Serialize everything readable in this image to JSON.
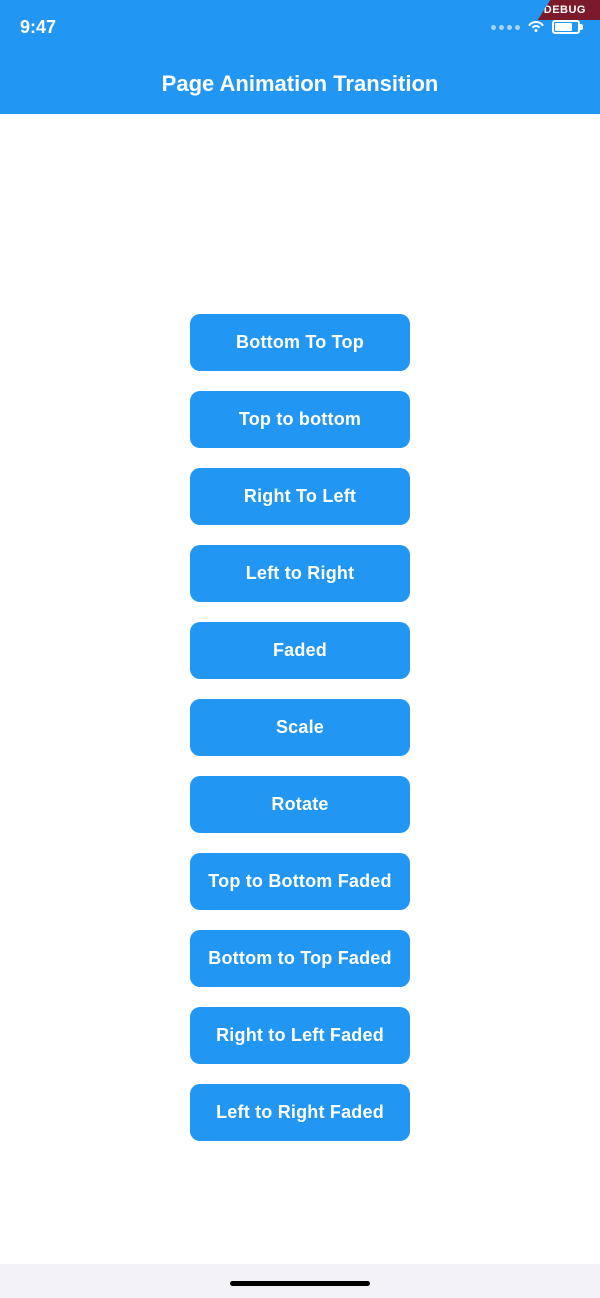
{
  "statusBar": {
    "time": "9:47"
  },
  "navBar": {
    "title": "Page Animation Transition"
  },
  "buttons": [
    {
      "id": "bottom-to-top",
      "label": "Bottom To Top"
    },
    {
      "id": "top-to-bottom",
      "label": "Top to bottom"
    },
    {
      "id": "right-to-left",
      "label": "Right To Left"
    },
    {
      "id": "left-to-right",
      "label": "Left to Right"
    },
    {
      "id": "faded",
      "label": "Faded"
    },
    {
      "id": "scale",
      "label": "Scale"
    },
    {
      "id": "rotate",
      "label": "Rotate"
    },
    {
      "id": "top-to-bottom-faded",
      "label": "Top to Bottom Faded"
    },
    {
      "id": "bottom-to-top-faded",
      "label": "Bottom to Top Faded"
    },
    {
      "id": "right-to-left-faded",
      "label": "Right to Left Faded"
    },
    {
      "id": "left-to-right-faded",
      "label": "Left to Right Faded"
    }
  ]
}
